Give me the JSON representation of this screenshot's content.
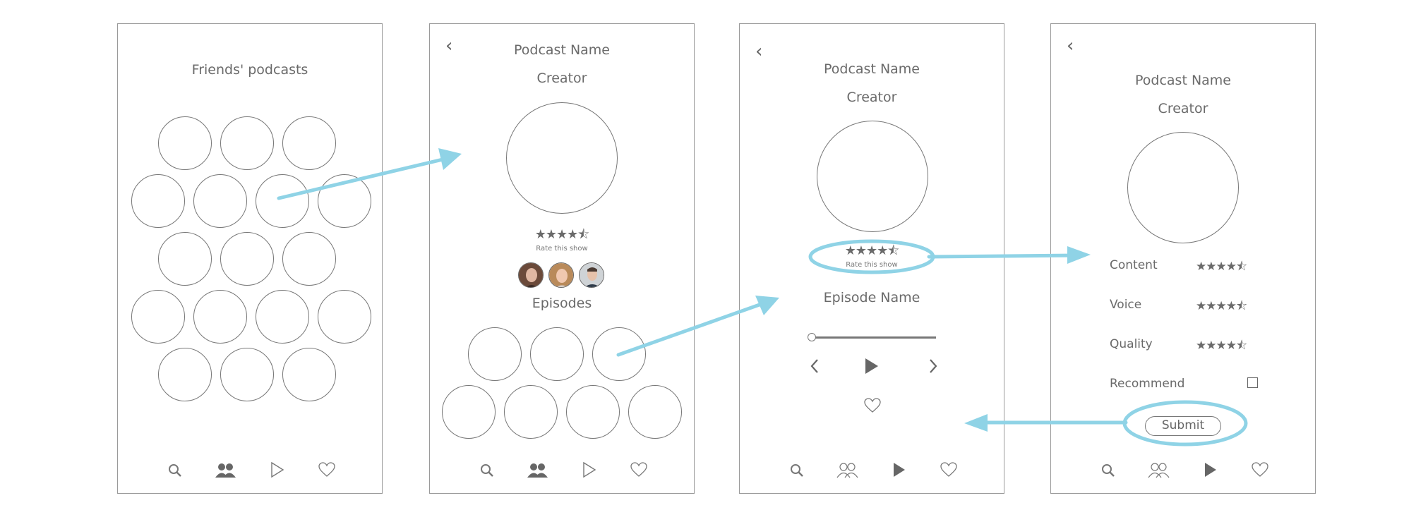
{
  "screen1": {
    "title": "Friends' podcasts",
    "nav": {
      "search_icon": "search-icon",
      "friends_icon": "friends-icon-filled",
      "play_icon": "play-icon-outline",
      "heart_icon": "heart-icon"
    }
  },
  "screen2": {
    "back_icon": "‹",
    "podcast_name": "Podcast Name",
    "creator": "Creator",
    "rating_stars": "★★★★⯪",
    "rate_label": "Rate this show",
    "episodes_label": "Episodes"
  },
  "screen3": {
    "back_icon": "‹",
    "podcast_name": "Podcast Name",
    "creator": "Creator",
    "rating_stars": "★★★★⯪",
    "rate_label": "Rate this show",
    "episode_name": "Episode Name",
    "progress": 0
  },
  "screen4": {
    "back_icon": "‹",
    "podcast_name": "Podcast Name",
    "creator": "Creator",
    "ratings": [
      {
        "label": "Content",
        "stars": "★★★★⯪"
      },
      {
        "label": "Voice",
        "stars": "★★★★⯪"
      },
      {
        "label": "Quality",
        "stars": "★★★★⯪"
      }
    ],
    "recommend_label": "Recommend",
    "submit_label": "Submit"
  },
  "colors": {
    "annotation": "#8fd3e6",
    "stroke": "#777777"
  }
}
